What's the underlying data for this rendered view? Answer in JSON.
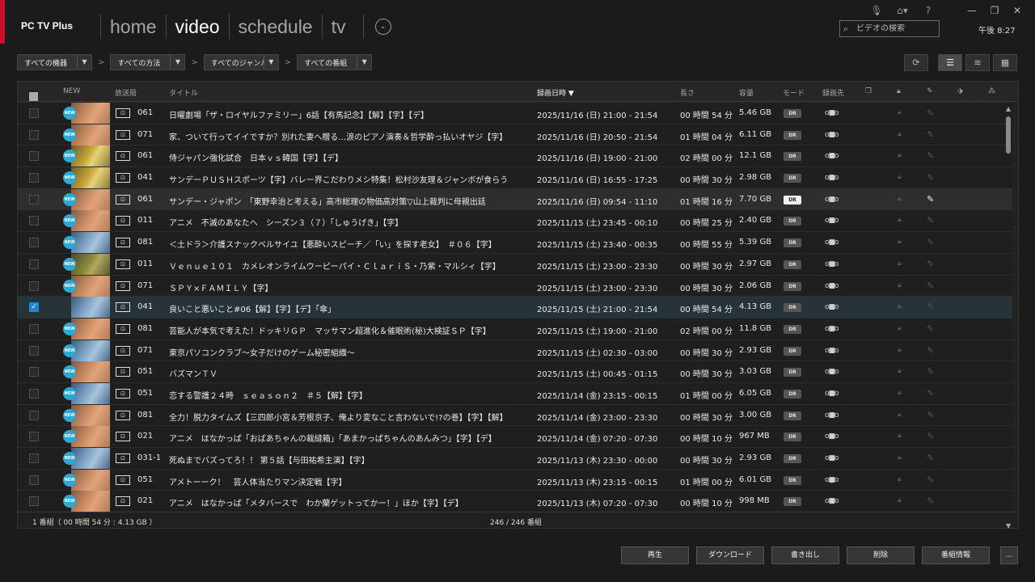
{
  "app": {
    "title": "PC TV Plus"
  },
  "nav": {
    "items": [
      "home",
      "video",
      "schedule",
      "tv"
    ],
    "active": "video",
    "more": "⌄"
  },
  "search": {
    "placeholder": "ビデオの検索"
  },
  "clock": "午後 8:27",
  "filters": [
    "すべての機器",
    "すべての方法",
    "すべてのジャンル",
    "すべての番組"
  ],
  "columns": {
    "new": "NEW",
    "station": "放送局",
    "title": "タイトル",
    "date": "録画日時 ▼",
    "length": "長さ",
    "size": "容量",
    "mode": "モード",
    "dest": "録画先"
  },
  "rows": [
    {
      "ch": "061",
      "title": "日曜劇場「ザ・ロイヤルファミリー」6話【有馬記念】【解】【字】【デ】",
      "date": "2025/11/16 (日) 21:00 - 21:54",
      "len": "00 時間 54 分",
      "size": "5.46 GB",
      "mode": "DR",
      "new": true,
      "thumb": "t-warm"
    },
    {
      "ch": "071",
      "title": "家、ついて行ってイイですか？別れた妻へ贈る…涙のピアノ演奏＆哲学酔っ払いオヤジ【字】",
      "date": "2025/11/16 (日) 20:50 - 21:54",
      "len": "01 時間 04 分",
      "size": "6.11 GB",
      "mode": "DR",
      "new": true,
      "thumb": "t-warm"
    },
    {
      "ch": "061",
      "title": "侍ジャパン強化試合　日本ｖｓ韓国【字】【デ】",
      "date": "2025/11/16 (日) 19:00 - 21:00",
      "len": "02 時間 00 分",
      "size": "12.1 GB",
      "mode": "DR",
      "new": true,
      "thumb": "t-gold"
    },
    {
      "ch": "041",
      "title": "サンデーＰＵＳＨスポーツ【字】バレー界こだわりメシ特集！松村沙友理＆ジャンボが食らう",
      "date": "2025/11/16 (日) 16:55 - 17:25",
      "len": "00 時間 30 分",
      "size": "2.98 GB",
      "mode": "DR",
      "new": true,
      "thumb": "t-gold"
    },
    {
      "ch": "061",
      "title": "サンデー・ジャポン　「東野幸治と考える」高市総理の物価高対策▽山上裁判に母親出廷",
      "date": "2025/11/16 (日) 09:54 - 11:10",
      "len": "01 時間 16 分",
      "size": "7.70 GB",
      "mode": "DR",
      "new": true,
      "thumb": "t-warm",
      "hover": true
    },
    {
      "ch": "011",
      "title": "アニメ　不滅のあなたへ　シーズン３（７）「しゅうげき」【字】",
      "date": "2025/11/15 (土) 23:45 - 00:10",
      "len": "00 時間 25 分",
      "size": "2.40 GB",
      "mode": "DR",
      "new": true,
      "thumb": "t-warm"
    },
    {
      "ch": "081",
      "title": "＜土ドラ＞介護スナックベルサイユ【悪酔いスピーチ／「い」を探す老女】　＃０６【字】",
      "date": "2025/11/15 (土) 23:40 - 00:35",
      "len": "00 時間 55 分",
      "size": "5.39 GB",
      "mode": "DR",
      "new": true,
      "thumb": "t-blue"
    },
    {
      "ch": "011",
      "title": "Ｖｅｎｕｅ１０１　カメレオンライムウーピーパイ・ＣｌａｒｉＳ・乃紫・マルシィ【字】",
      "date": "2025/11/15 (土) 23:00 - 23:30",
      "len": "00 時間 30 分",
      "size": "2.97 GB",
      "mode": "DR",
      "new": true,
      "thumb": "t-olive"
    },
    {
      "ch": "071",
      "title": "ＳＰＹ×ＦＡＭＩＬＹ【字】",
      "date": "2025/11/15 (土) 23:00 - 23:30",
      "len": "00 時間 30 分",
      "size": "2.06 GB",
      "mode": "DR",
      "new": true,
      "thumb": "t-warm"
    },
    {
      "ch": "041",
      "title": "良いこと悪いこと#06【解】【字】【デ】「傘」",
      "date": "2025/11/15 (土) 21:00 - 21:54",
      "len": "00 時間 54 分",
      "size": "4.13 GB",
      "mode": "DR",
      "new": false,
      "thumb": "t-blue",
      "checked": true
    },
    {
      "ch": "081",
      "title": "芸能人が本気で考えた！ドッキリＧＰ　マッサマン超進化＆催眠術(秘)大検証ＳＰ【字】",
      "date": "2025/11/15 (土) 19:00 - 21:00",
      "len": "02 時間 00 分",
      "size": "11.8 GB",
      "mode": "DR",
      "new": true,
      "thumb": "t-warm"
    },
    {
      "ch": "071",
      "title": "東京パソコンクラブ～女子だけのゲーム秘密組織～",
      "date": "2025/11/15 (土) 02:30 - 03:00",
      "len": "00 時間 30 分",
      "size": "2.93 GB",
      "mode": "DR",
      "new": true,
      "thumb": "t-blue"
    },
    {
      "ch": "051",
      "title": "バズマンＴＶ",
      "date": "2025/11/15 (土) 00:45 - 01:15",
      "len": "00 時間 30 分",
      "size": "3.03 GB",
      "mode": "DR",
      "new": true,
      "thumb": "t-warm"
    },
    {
      "ch": "051",
      "title": "恋する警護２４時　ｓｅａｓｏｎ２　＃５【解】【字】",
      "date": "2025/11/14 (金) 23:15 - 00:15",
      "len": "01 時間 00 分",
      "size": "6.05 GB",
      "mode": "DR",
      "new": true,
      "thumb": "t-blue"
    },
    {
      "ch": "081",
      "title": "全力！脱力タイムズ【三四郎小宮＆芳根京子、俺より変なこと言わないで!?の巻】【字】【解】",
      "date": "2025/11/14 (金) 23:00 - 23:30",
      "len": "00 時間 30 分",
      "size": "3.00 GB",
      "mode": "DR",
      "new": true,
      "thumb": "t-warm"
    },
    {
      "ch": "021",
      "title": "アニメ　はなかっぱ「おばあちゃんの裁縫箱」「あまかっぱちゃんのあんみつ」【字】【デ】",
      "date": "2025/11/14 (金) 07:20 - 07:30",
      "len": "00 時間 10 分",
      "size": "967 MB",
      "mode": "DR",
      "new": true,
      "thumb": "t-warm"
    },
    {
      "ch": "031-1",
      "title": "死ぬまでバズってろ！！ 第５話【与田祐希主演】【字】",
      "date": "2025/11/13 (木) 23:30 - 00:00",
      "len": "00 時間 30 分",
      "size": "2.93 GB",
      "mode": "DR",
      "new": true,
      "thumb": "t-blue"
    },
    {
      "ch": "051",
      "title": "アメトーーク！　芸人体当たりマン決定戦【字】",
      "date": "2025/11/13 (木) 23:15 - 00:15",
      "len": "01 時間 00 分",
      "size": "6.01 GB",
      "mode": "DR",
      "new": true,
      "thumb": "t-warm"
    },
    {
      "ch": "021",
      "title": "アニメ　はなかっぱ「メタバースで　わか蘭ゲットってかー！」ほか【字】【デ】",
      "date": "2025/11/13 (木) 07:20 - 07:30",
      "len": "00 時間 10 分",
      "size": "998 MB",
      "mode": "DR",
      "new": true,
      "thumb": "t-warm"
    }
  ],
  "footer": {
    "selection": "1 番組（ 00 時間 54 分 : 4.13 GB ）",
    "count": "246 / 246 番組"
  },
  "actions": [
    "再生",
    "ダウンロード",
    "書き出し",
    "削除",
    "番組情報",
    "…"
  ],
  "scroll": {
    "position_fraction": 0.0
  }
}
